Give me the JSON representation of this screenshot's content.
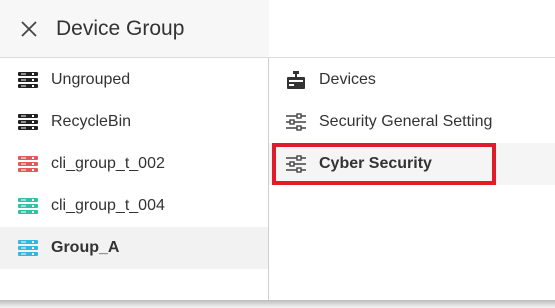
{
  "header": {
    "title": "Device Group",
    "close_icon": "close-icon"
  },
  "groups": [
    {
      "label": "Ungrouped",
      "icon": "server-rack-icon",
      "color": "#222222"
    },
    {
      "label": "RecycleBin",
      "icon": "server-rack-icon",
      "color": "#222222"
    },
    {
      "label": "cli_group_t_002",
      "icon": "server-rack-icon",
      "color": "#e05a5a"
    },
    {
      "label": "cli_group_t_004",
      "icon": "server-rack-icon",
      "color": "#2cc3a6"
    },
    {
      "label": "Group_A",
      "icon": "server-rack-icon",
      "color": "#35b6dc",
      "selected": true
    }
  ],
  "menu": [
    {
      "label": "Devices",
      "icon": "devices-icon"
    },
    {
      "label": "Security General Setting",
      "icon": "sliders-icon"
    },
    {
      "label": "Cyber Security",
      "icon": "sliders-icon",
      "active": true,
      "highlight_color": "#e01c2a"
    }
  ]
}
